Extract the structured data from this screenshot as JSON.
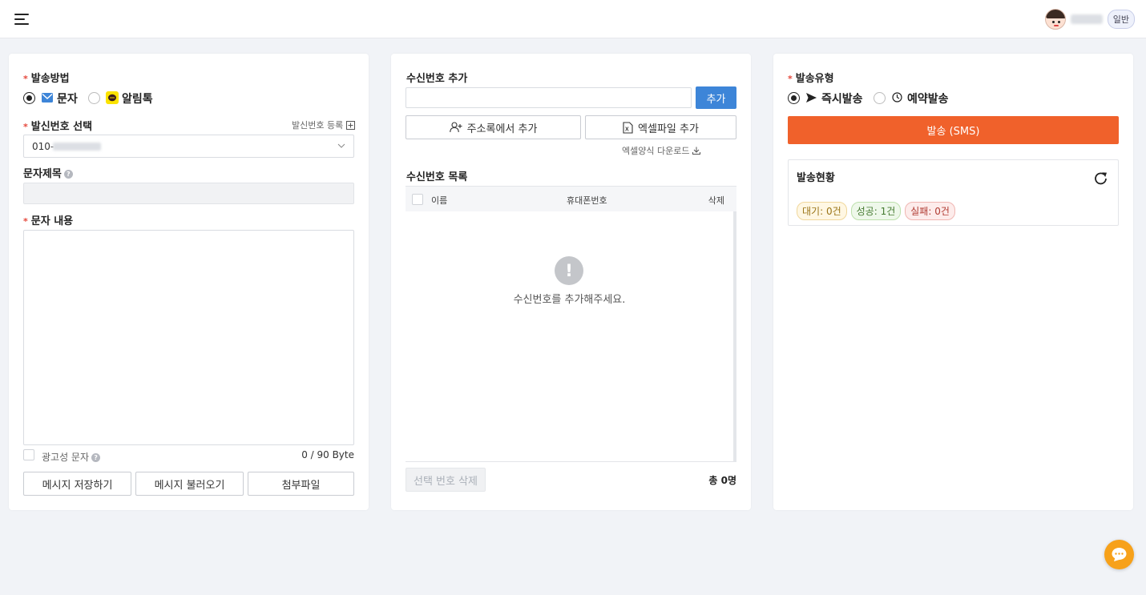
{
  "header": {
    "menu_icon": "menu-icon",
    "user_grade": "일반"
  },
  "left": {
    "send_method_label": "발송방법",
    "method_sms": "문자",
    "method_alimtalk": "알림톡",
    "sender_label": "발신번호 선택",
    "sender_register": "발신번호 등록",
    "sender_value": "010-",
    "title_label": "문자제목",
    "content_label": "문자 내용",
    "ad_label": "광고성 문자",
    "byte_count": "0 / 90 Byte",
    "save_button": "메시지 저장하기",
    "load_button": "메시지 불러오기",
    "attach_button": "첨부파일"
  },
  "middle": {
    "add_label": "수신번호 추가",
    "add_button": "추가",
    "addressbook_button": "주소록에서 추가",
    "excel_button": "엑셀파일 추가",
    "excel_download": "엑셀양식 다운로드",
    "list_label": "수신번호 목록",
    "columns": [
      "이름",
      "휴대폰번호",
      "삭제"
    ],
    "empty_message": "수신번호를 추가해주세요.",
    "delete_selected": "선택 번호 삭제",
    "total": "총 0명"
  },
  "right": {
    "send_type_label": "발송유형",
    "type_now": "즉시발송",
    "type_reserve": "예약발송",
    "send_button": "발송 (SMS)",
    "status_title": "발송현황",
    "chips": {
      "waiting": "대기: 0건",
      "success": "성공: 1건",
      "fail": "실패: 0건"
    }
  },
  "colors": {
    "accent_blue": "#3d85d8",
    "send_orange": "#f0612b",
    "chat_orange": "#f7a11a",
    "required_red": "#e5473b"
  }
}
